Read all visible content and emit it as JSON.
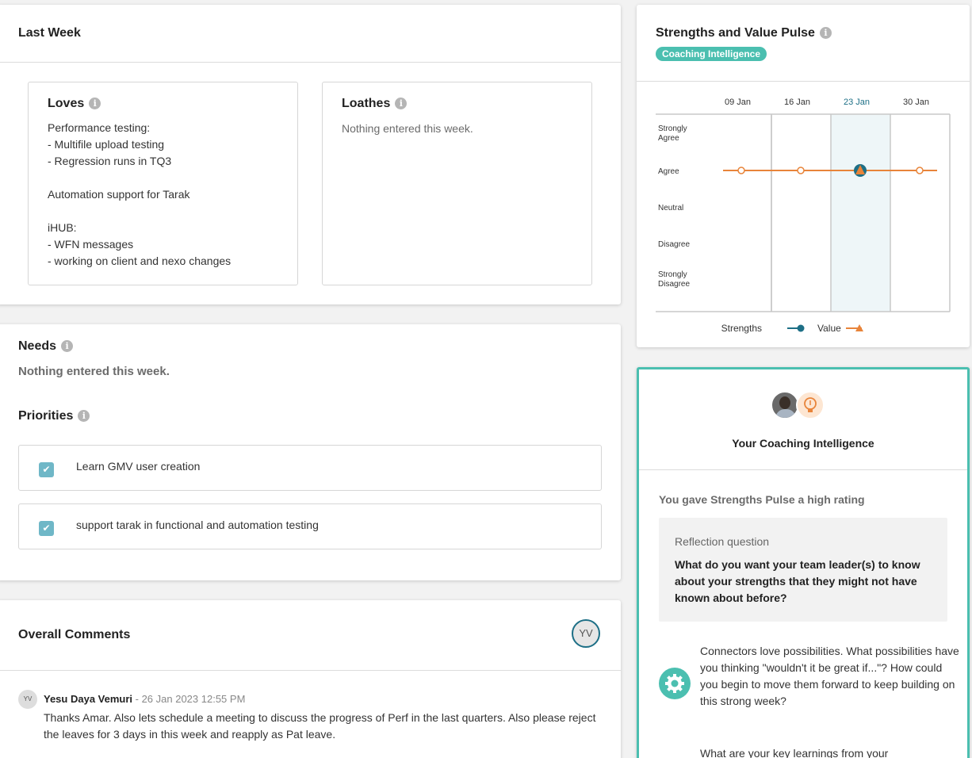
{
  "last_week": {
    "title": "Last Week",
    "loves": {
      "title": "Loves",
      "text": "Performance testing:\n- Multifile upload testing\n- Regression runs in TQ3\n\nAutomation support for Tarak\n\niHUB:\n- WFN messages\n- working on client and nexo changes"
    },
    "loathes": {
      "title": "Loathes",
      "text": "Nothing entered this week."
    }
  },
  "needs": {
    "title": "Needs",
    "text": "Nothing entered this week."
  },
  "priorities": {
    "title": "Priorities",
    "items": [
      {
        "label": "Learn GMV user creation",
        "checked": true
      },
      {
        "label": "support tarak in functional and automation testing",
        "checked": true
      }
    ]
  },
  "comments": {
    "title": "Overall Comments",
    "user_initials": "YV",
    "items": [
      {
        "initials": "YV",
        "author": "Yesu Daya Vemuri",
        "separator": " - ",
        "timestamp": "26 Jan 2023 12:55 PM",
        "text": "Thanks Amar. Also lets schedule a meeting to discuss the progress of Perf in the last quarters. Also please reject the leaves for 3 days in this week and reapply as Pat leave."
      }
    ]
  },
  "pulse": {
    "title": "Strengths and Value Pulse",
    "badge": "Coaching Intelligence",
    "legend": {
      "strengths": "Strengths",
      "value": "Value"
    },
    "colors": {
      "strengths": "#1d6f86",
      "value": "#e8843a",
      "highlight": "#eef6f8",
      "badge": "#4bbfb0"
    }
  },
  "chart_data": {
    "type": "line",
    "x": [
      "09 Jan",
      "16 Jan",
      "23 Jan",
      "30 Jan"
    ],
    "y_categories": [
      "Strongly Agree",
      "Agree",
      "Neutral",
      "Disagree",
      "Strongly Disagree"
    ],
    "highlighted_x": "23 Jan",
    "series": [
      {
        "name": "Strengths",
        "values": [
          null,
          null,
          "Agree",
          null
        ]
      },
      {
        "name": "Value",
        "values": [
          "Agree",
          "Agree",
          "Agree",
          "Agree"
        ]
      }
    ],
    "legend_position": "bottom"
  },
  "coaching": {
    "title": "Your Coaching Intelligence",
    "rating_text": "You gave Strengths Pulse a high rating",
    "reflection_label": "Reflection question",
    "reflection_question": "What do you want your team leader(s) to know about your strengths that they might not have known about before?",
    "tip_icon": "gear-icon",
    "tip_text": "Connectors love possibilities. What possibilities have you thinking \"wouldn't it be great if...\"? How could you begin to move them forward to keep building on this strong week?",
    "tip_text_2": "What are your key learnings from your"
  }
}
